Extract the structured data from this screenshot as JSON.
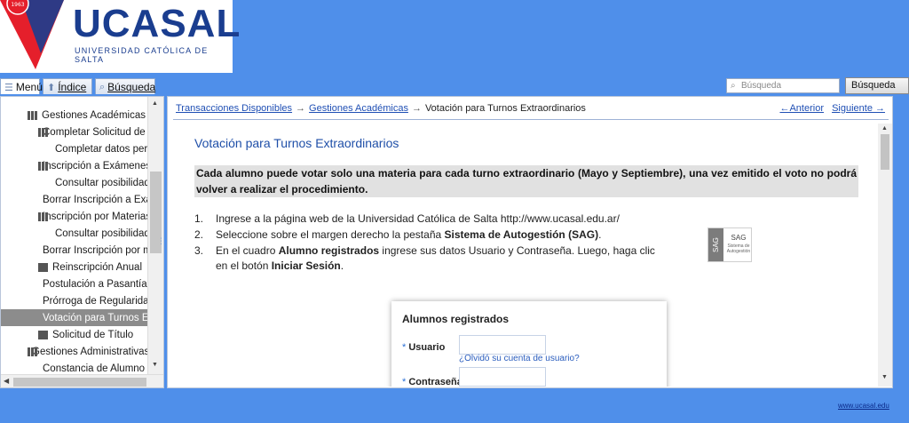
{
  "header": {
    "logo_name": "UCASAL",
    "logo_subtitle": "UNIVERSIDAD CATÓLICA DE SALTA",
    "logo_badge": "1963",
    "colors": {
      "brand_red": "#e51f2b",
      "brand_blue": "#1a3d8f",
      "bg": "#4f8fea"
    }
  },
  "tabs": [
    {
      "label": "Menú",
      "icon": "menu-icon"
    },
    {
      "label": "Índice",
      "icon": "index-icon"
    },
    {
      "label": "Búsqueda",
      "icon": "search-icon"
    }
  ],
  "search": {
    "placeholder": "Búsqueda",
    "button_label": "Búsqueda"
  },
  "tree": [
    {
      "label": "Gestiones Académicas",
      "icon": "books-icon",
      "level": 1
    },
    {
      "label": "Completar Solicitud de Ir",
      "icon": "books-icon",
      "level": 2
    },
    {
      "label": "Completar datos pers",
      "icon": "book-icon",
      "level": 3
    },
    {
      "label": "Inscripción a Exámenes",
      "icon": "books-icon",
      "level": 2
    },
    {
      "label": "Consultar posibilidade",
      "icon": "book-icon",
      "level": 3
    },
    {
      "label": "Borrar Inscripción a Exár",
      "icon": "book-icon",
      "level": 2
    },
    {
      "label": "Inscripción por Materias",
      "icon": "books-icon",
      "level": 2
    },
    {
      "label": "Consultar posibilidade",
      "icon": "book-icon",
      "level": 3
    },
    {
      "label": "Borrar Inscripción por ma",
      "icon": "book-icon",
      "level": 2
    },
    {
      "label": "Reinscripción Anual",
      "icon": "book-icon",
      "level": 2
    },
    {
      "label": "Postulación a Pasantías",
      "icon": "book-icon",
      "level": 2
    },
    {
      "label": "Prórroga de Regularidad",
      "icon": "book-icon",
      "level": 2
    },
    {
      "label": "Votación para Turnos Ex",
      "icon": "book-icon",
      "level": 2,
      "selected": true
    },
    {
      "label": "Solicitud de Título",
      "icon": "book-icon",
      "level": 2
    },
    {
      "label": "Gestiones Administrativas",
      "icon": "books-icon",
      "level": 1
    },
    {
      "label": "Constancia de Alumno R",
      "icon": "book-icon",
      "level": 2
    }
  ],
  "breadcrumb": {
    "items": [
      "Transacciones Disponibles",
      "Gestiones Académicas"
    ],
    "current": "Votación para Turnos Extraordinarios",
    "prev_label": "←Anterior",
    "next_label": "Siguiente →"
  },
  "main": {
    "title": "Votación para Turnos Extraordinarios",
    "notice": "Cada alumno puede votar solo una materia para cada turno extraordinario (Mayo y Septiembre), una vez emitido el voto no podrá volver a realizar el procedimiento.",
    "steps": [
      {
        "num": "1.",
        "pre": "Ingrese a la página web de la Universidad Católica de Salta http://www.ucasal.edu.ar/",
        "bold": "",
        "post": ""
      },
      {
        "num": "2.",
        "pre": "Seleccione sobre el margen derecho la pestaña ",
        "bold": "Sistema de Autogestión (SAG)",
        "post": "."
      },
      {
        "num": "3.",
        "pre": "En el cuadro  ",
        "bold": "Alumno registrados",
        "post": " ingrese sus datos Usuario y Contraseña. Luego, haga clic en el botón ",
        "bold2": "Iniciar Sesión",
        "post2": "."
      }
    ],
    "sag_logo": {
      "abbr": "SAG",
      "title": "SAG",
      "subtitle": "Sistema de Autogestión"
    },
    "login": {
      "title": "Alumnos registrados",
      "user_label": "Usuario",
      "password_label": "Contraseña",
      "required_mark": "*",
      "forgot_link": "¿Olvidó su cuenta de usuario?"
    }
  },
  "footer": {
    "link": "www.ucasal.edu"
  }
}
